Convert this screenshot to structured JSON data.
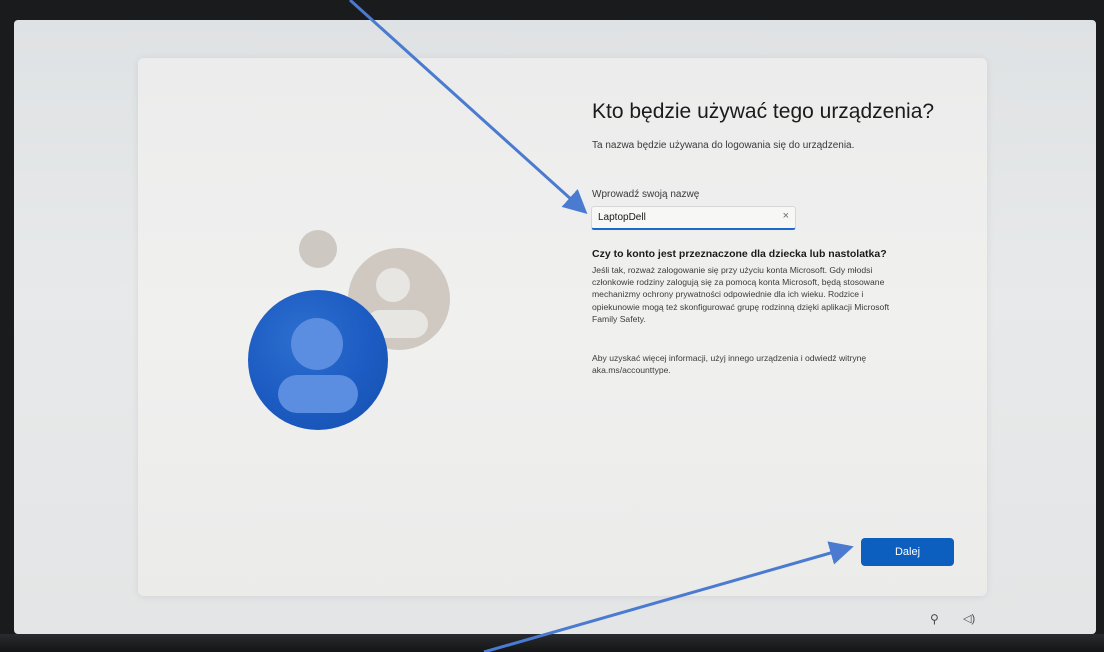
{
  "oobe": {
    "title": "Kto będzie używać tego urządzenia?",
    "subtitle": "Ta nazwa będzie używana do logowania się do urządzenia.",
    "name_field": {
      "label": "Wprowadź swoją nazwę",
      "value": "LaptopDell",
      "clear_icon": "×"
    },
    "child_account": {
      "heading": "Czy to konto jest przeznaczone dla dziecka lub nastolatka?",
      "body_lines": [
        "Jeśli tak, rozważ zalogowanie się przy użyciu konta Microsoft. Gdy młodsi",
        "członkowie rodziny zalogują się za pomocą konta Microsoft, będą stosowane",
        "mechanizmy ochrony prywatności odpowiednie dla ich wieku. Rodzice i",
        "opiekunowie mogą też skonfigurować grupę rodzinną dzięki aplikacji Microsoft",
        "Family Safety."
      ],
      "more_info_lines": [
        "Aby uzyskać więcej informacji, użyj innego urządzenia i odwiedź witrynę",
        "aka.ms/accounttype."
      ]
    },
    "next_button": "Dalej"
  },
  "taskbar": {
    "accessibility_icon": "accessibility-icon",
    "volume_icon": "volume-icon",
    "accessibility_glyph": "⚲",
    "volume_glyph": "◁)"
  },
  "colors": {
    "accent": "#0c5fbe",
    "annotation_arrow": "#4a7bd0"
  }
}
